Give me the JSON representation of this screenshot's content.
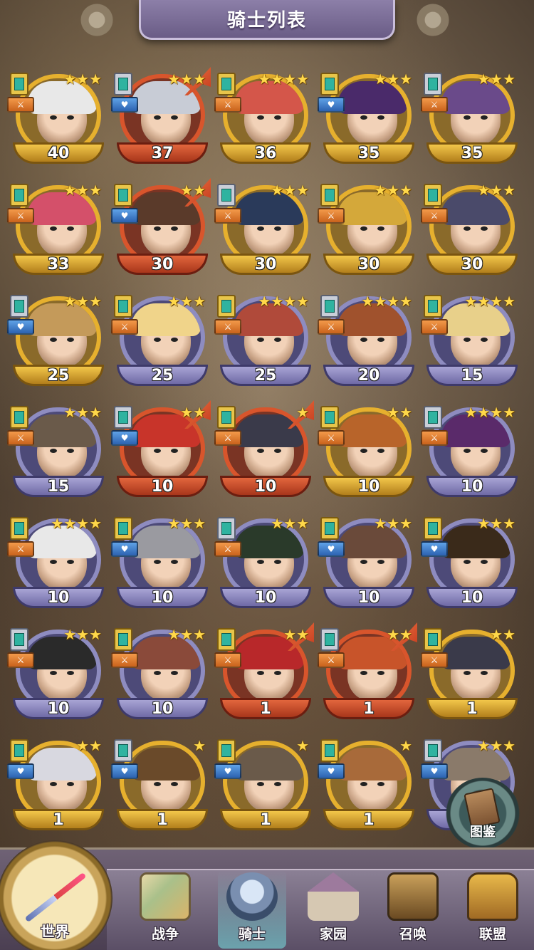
{
  "title": "骑士列表",
  "codex_label": "图鉴",
  "nav": {
    "world": "世界",
    "war": "战争",
    "knights": "骑士",
    "home": "家园",
    "summon": "召唤",
    "alliance": "联盟"
  },
  "knights": [
    {
      "level": "40",
      "stars": 3,
      "rarity": "gold",
      "promote": false,
      "badge": "orange"
    },
    {
      "level": "37",
      "stars": 3,
      "rarity": "red",
      "promote": true,
      "badge": "blue"
    },
    {
      "level": "36",
      "stars": 4,
      "rarity": "gold",
      "promote": false,
      "badge": "orange"
    },
    {
      "level": "35",
      "stars": 3,
      "rarity": "gold",
      "promote": false,
      "badge": "blue"
    },
    {
      "level": "35",
      "stars": 3,
      "rarity": "gold",
      "promote": false,
      "badge": "orange"
    },
    {
      "level": "33",
      "stars": 3,
      "rarity": "gold",
      "promote": false,
      "badge": "orange"
    },
    {
      "level": "30",
      "stars": 2,
      "rarity": "red",
      "promote": true,
      "badge": "blue"
    },
    {
      "level": "30",
      "stars": 3,
      "rarity": "gold",
      "promote": false,
      "badge": "orange"
    },
    {
      "level": "30",
      "stars": 3,
      "rarity": "gold",
      "promote": false,
      "badge": "orange"
    },
    {
      "level": "30",
      "stars": 3,
      "rarity": "gold",
      "promote": false,
      "badge": "orange"
    },
    {
      "level": "25",
      "stars": 3,
      "rarity": "gold",
      "promote": false,
      "badge": "blue"
    },
    {
      "level": "25",
      "stars": 3,
      "rarity": "purple",
      "promote": false,
      "badge": "orange"
    },
    {
      "level": "25",
      "stars": 4,
      "rarity": "purple",
      "promote": false,
      "badge": "orange"
    },
    {
      "level": "20",
      "stars": 4,
      "rarity": "purple",
      "promote": false,
      "badge": "orange"
    },
    {
      "level": "15",
      "stars": 4,
      "rarity": "purple",
      "promote": false,
      "badge": "orange"
    },
    {
      "level": "15",
      "stars": 3,
      "rarity": "purple",
      "promote": false,
      "badge": "orange"
    },
    {
      "level": "10",
      "stars": 2,
      "rarity": "red",
      "promote": true,
      "badge": "blue"
    },
    {
      "level": "10",
      "stars": 1,
      "rarity": "red",
      "promote": true,
      "badge": "orange"
    },
    {
      "level": "10",
      "stars": 2,
      "rarity": "gold",
      "promote": false,
      "badge": "orange"
    },
    {
      "level": "10",
      "stars": 4,
      "rarity": "purple",
      "promote": false,
      "badge": "orange"
    },
    {
      "level": "10",
      "stars": 4,
      "rarity": "purple",
      "promote": false,
      "badge": "orange"
    },
    {
      "level": "10",
      "stars": 3,
      "rarity": "purple",
      "promote": false,
      "badge": "blue"
    },
    {
      "level": "10",
      "stars": 3,
      "rarity": "purple",
      "promote": false,
      "badge": "orange"
    },
    {
      "level": "10",
      "stars": 3,
      "rarity": "purple",
      "promote": false,
      "badge": "blue"
    },
    {
      "level": "10",
      "stars": 3,
      "rarity": "purple",
      "promote": false,
      "badge": "blue"
    },
    {
      "level": "10",
      "stars": 3,
      "rarity": "purple",
      "promote": false,
      "badge": "orange"
    },
    {
      "level": "10",
      "stars": 3,
      "rarity": "purple",
      "promote": false,
      "badge": "orange"
    },
    {
      "level": "1",
      "stars": 2,
      "rarity": "red",
      "promote": true,
      "badge": "orange"
    },
    {
      "level": "1",
      "stars": 2,
      "rarity": "red",
      "promote": true,
      "badge": "orange"
    },
    {
      "level": "1",
      "stars": 2,
      "rarity": "gold",
      "promote": false,
      "badge": "orange"
    },
    {
      "level": "1",
      "stars": 2,
      "rarity": "gold",
      "promote": false,
      "badge": "blue"
    },
    {
      "level": "1",
      "stars": 1,
      "rarity": "gold",
      "promote": false,
      "badge": "blue"
    },
    {
      "level": "1",
      "stars": 1,
      "rarity": "gold",
      "promote": false,
      "badge": "blue"
    },
    {
      "level": "1",
      "stars": 1,
      "rarity": "gold",
      "promote": false,
      "badge": "blue"
    },
    {
      "level": "",
      "stars": 3,
      "rarity": "purple",
      "promote": false,
      "badge": "blue"
    }
  ],
  "colors": {
    "gold": "#e6b02e",
    "red": "#d8552c",
    "purple": "#8e8cc0",
    "star": "#ffd84a",
    "title_banner": "#7a6d98",
    "nav_active": "#78e6e6"
  }
}
